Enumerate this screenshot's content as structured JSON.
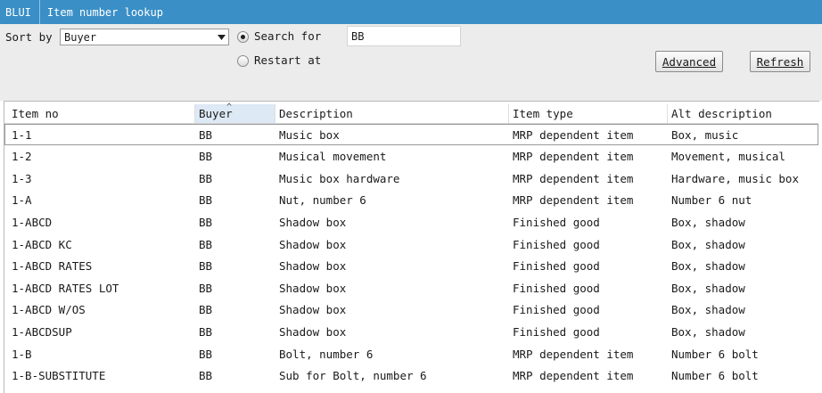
{
  "titlebar": {
    "app": "BLUI",
    "title": "Item number lookup"
  },
  "controls": {
    "sort_by_label": "Sort by",
    "sort_by_value": "Buyer",
    "search_for_label": "Search for",
    "search_value": "BB",
    "restart_at_label": "Restart at",
    "advanced_label": "Advanced",
    "refresh_label": "Refresh",
    "selected_mode": "Search for"
  },
  "grid": {
    "columns": [
      "Item no",
      "Buyer",
      "Description",
      "Item type",
      "Alt description"
    ],
    "sorted_column": "Buyer",
    "rows": [
      [
        "1-1",
        "BB",
        "Music box",
        "MRP dependent item",
        "Box, music"
      ],
      [
        "1-2",
        "BB",
        "Musical movement",
        "MRP dependent item",
        "Movement, musical"
      ],
      [
        "1-3",
        "BB",
        "Music box hardware",
        "MRP dependent item",
        "Hardware, music box"
      ],
      [
        "1-A",
        "BB",
        "Nut, number 6",
        "MRP dependent item",
        "Number 6 nut"
      ],
      [
        "1-ABCD",
        "BB",
        "Shadow box",
        "Finished good",
        "Box, shadow"
      ],
      [
        "1-ABCD KC",
        "BB",
        "Shadow box",
        "Finished good",
        "Box, shadow"
      ],
      [
        "1-ABCD RATES",
        "BB",
        "Shadow box",
        "Finished good",
        "Box, shadow"
      ],
      [
        "1-ABCD RATES LOT",
        "BB",
        "Shadow box",
        "Finished good",
        "Box, shadow"
      ],
      [
        "1-ABCD W/OS",
        "BB",
        "Shadow box",
        "Finished good",
        "Box, shadow"
      ],
      [
        "1-ABCDSUP",
        "BB",
        "Shadow box",
        "Finished good",
        "Box, shadow"
      ],
      [
        "1-B",
        "BB",
        "Bolt, number 6",
        "MRP dependent item",
        "Number 6 bolt"
      ],
      [
        "1-B-SUBSTITUTE",
        "BB",
        "Sub for Bolt, number 6",
        "MRP dependent item",
        "Number 6 bolt"
      ]
    ],
    "selected_row": 0
  },
  "icons": {
    "dropdown": "chevron-down-icon",
    "sort": "sort-ascending-icon"
  },
  "colors": {
    "titlebar": "#3a8fc6",
    "panel": "#ececec",
    "sorted_header": "#dde9f5"
  }
}
